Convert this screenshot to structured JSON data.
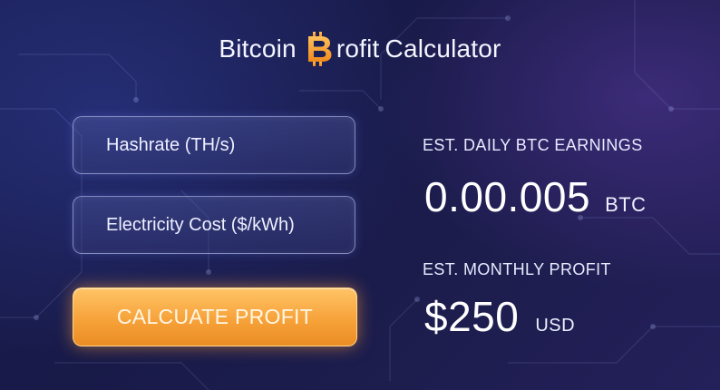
{
  "header": {
    "title_part1": "Bitcoin",
    "logo_icon": "bitcoin-b-logo-icon",
    "title_part2": "rofit",
    "title_part3": "Calculator"
  },
  "form": {
    "hashrate_placeholder": "Hashrate (TH/s)",
    "electricity_placeholder": "Electricity Cost ($/kWh)",
    "calculate_label": "CALCUATE PROFIT"
  },
  "results": {
    "daily_label": "EST. DAILY BTC EARNINGS",
    "daily_value": "0.00.005",
    "daily_unit": "BTC",
    "monthly_label": "EST. MONTHLY PROFIT",
    "monthly_value": "$250",
    "monthly_unit": "USD"
  },
  "colors": {
    "accent_orange": "#f7a23a",
    "background": "#1b1f55"
  }
}
